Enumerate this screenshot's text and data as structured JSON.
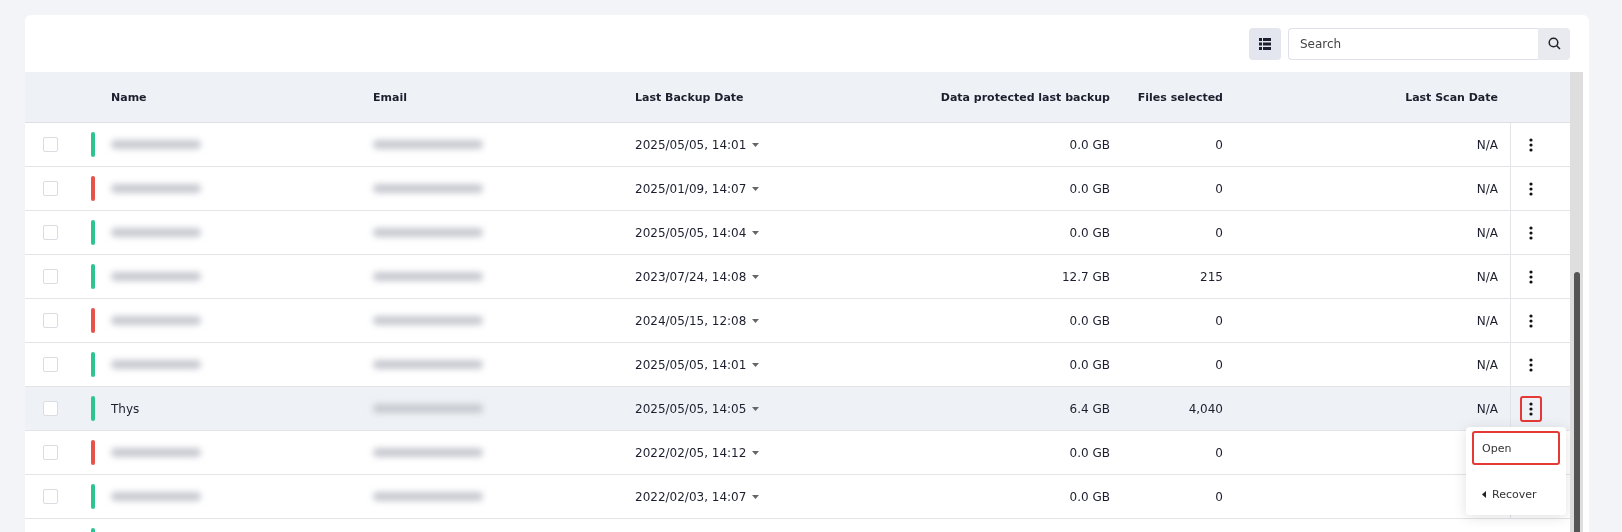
{
  "toolbar": {
    "search": {
      "placeholder": "Search"
    }
  },
  "table": {
    "columns": [
      {
        "label": "Name"
      },
      {
        "label": "Email"
      },
      {
        "label": "Last Backup Date"
      },
      {
        "label": "Data protected last backup"
      },
      {
        "label": "Files selected"
      },
      {
        "label": "Last Scan Date"
      }
    ],
    "rows": [
      {
        "checked": false,
        "color": "#2ec48f",
        "name_blurred": true,
        "email_blurred": true,
        "last_backup": "2025/05/05, 14:01",
        "data": "0.0 GB",
        "files": "0",
        "last_scan": "N/A",
        "has_actions": true,
        "selected": false,
        "highlighted": false
      },
      {
        "checked": false,
        "color": "#e5534b",
        "name_blurred": true,
        "email_blurred": true,
        "last_backup": "2025/01/09, 14:07",
        "data": "0.0 GB",
        "files": "0",
        "last_scan": "N/A",
        "has_actions": true,
        "selected": false,
        "highlighted": false
      },
      {
        "checked": false,
        "color": "#2ec48f",
        "name_blurred": true,
        "email_blurred": true,
        "last_backup": "2025/05/05, 14:04",
        "data": "0.0 GB",
        "files": "0",
        "last_scan": "N/A",
        "has_actions": true,
        "selected": false,
        "highlighted": false
      },
      {
        "checked": false,
        "color": "#2ec48f",
        "name_blurred": true,
        "email_blurred": true,
        "last_backup": "2023/07/24, 14:08",
        "data": "12.7 GB",
        "files": "215",
        "last_scan": "N/A",
        "has_actions": true,
        "selected": false,
        "highlighted": false
      },
      {
        "checked": false,
        "color": "#e5534b",
        "name_blurred": true,
        "email_blurred": true,
        "last_backup": "2024/05/15, 12:08",
        "data": "0.0 GB",
        "files": "0",
        "last_scan": "N/A",
        "has_actions": true,
        "selected": false,
        "highlighted": false
      },
      {
        "checked": false,
        "color": "#2ec48f",
        "name_blurred": true,
        "email_blurred": true,
        "last_backup": "2025/05/05, 14:01",
        "data": "0.0 GB",
        "files": "0",
        "last_scan": "N/A",
        "has_actions": true,
        "selected": false,
        "highlighted": false
      },
      {
        "checked": false,
        "color": "#2ec48f",
        "name": "Thys",
        "name_blurred": false,
        "email_blurred": true,
        "last_backup": "2025/05/05, 14:05",
        "data": "6.4 GB",
        "files": "4,040",
        "last_scan": "N/A",
        "has_actions": true,
        "selected": true,
        "highlighted": true
      },
      {
        "checked": false,
        "color": "#e5534b",
        "name_blurred": true,
        "email_blurred": true,
        "last_backup": "2022/02/05, 14:12",
        "data": "0.0 GB",
        "files": "0",
        "has_actions": false,
        "selected": false
      },
      {
        "checked": false,
        "color": "#2ec48f",
        "name_blurred": true,
        "email_blurred": true,
        "last_backup": "2022/02/03, 14:07",
        "data": "0.0 GB",
        "files": "0",
        "has_actions": false,
        "selected": false
      },
      {
        "color": "#2ec48f",
        "partial": true
      }
    ]
  },
  "menu": {
    "items": [
      {
        "kind": "plain",
        "label": "Open",
        "highlighted": true
      },
      {
        "kind": "submenu",
        "label": "Recover",
        "highlighted": false
      }
    ]
  }
}
